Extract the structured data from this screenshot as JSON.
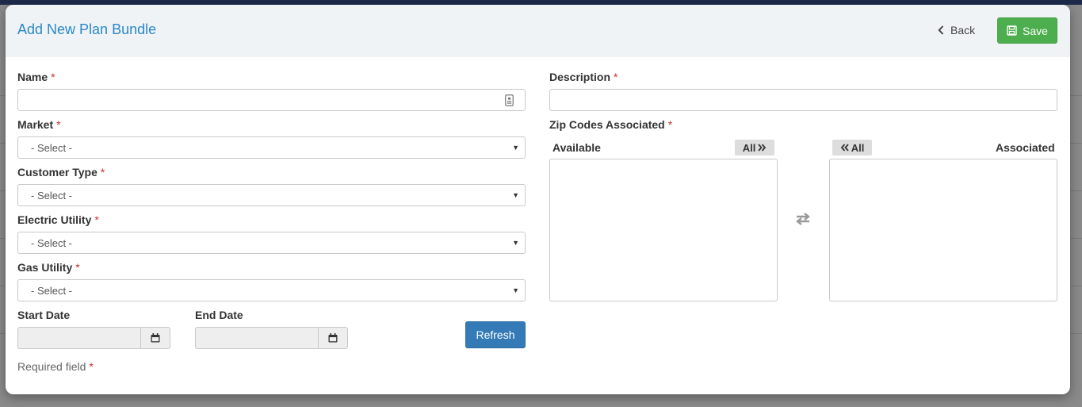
{
  "modal": {
    "title": "Add New Plan Bundle"
  },
  "header": {
    "back_label": "Back",
    "save_label": "Save"
  },
  "form": {
    "required_marker": "*",
    "name": {
      "label": "Name",
      "value": "",
      "placeholder": ""
    },
    "market": {
      "label": "Market",
      "value": "- Select -"
    },
    "customer_type": {
      "label": "Customer Type",
      "value": "- Select -"
    },
    "electric_utility": {
      "label": "Electric Utility",
      "value": "- Select -"
    },
    "gas_utility": {
      "label": "Gas Utility",
      "value": "- Select -"
    },
    "start_date": {
      "label": "Start Date",
      "value": ""
    },
    "end_date": {
      "label": "End Date",
      "value": ""
    },
    "refresh_label": "Refresh",
    "required_note": "Required field",
    "description": {
      "label": "Description",
      "value": ""
    },
    "zip_codes": {
      "label": "Zip Codes Associated",
      "available_label": "Available",
      "associated_label": "Associated",
      "move_all_right_label": "All",
      "move_all_left_label": "All",
      "available_items": [],
      "associated_items": []
    }
  },
  "colors": {
    "accent_title": "#2a88c8",
    "save_green": "#4cae4c",
    "refresh_blue": "#337ab7",
    "required_red": "#c9302c"
  },
  "icons": [
    "chevron-left-icon",
    "floppy-disk-icon",
    "id-card-icon",
    "caret-down-icon",
    "calendar-icon",
    "double-chevron-right-icon",
    "double-chevron-left-icon",
    "swap-arrows-icon"
  ]
}
